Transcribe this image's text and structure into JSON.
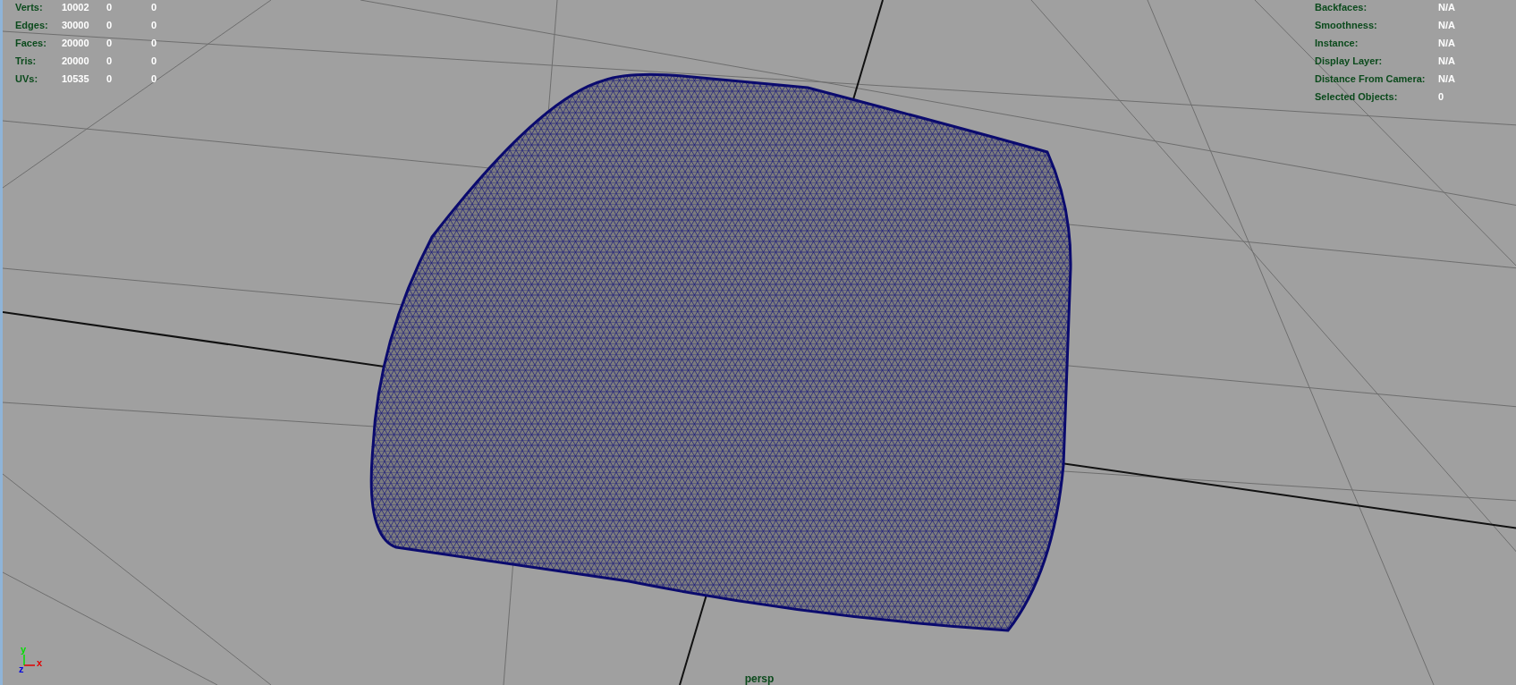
{
  "poly_count": [
    {
      "label": "Verts:",
      "values": [
        "10002",
        "0",
        "0"
      ]
    },
    {
      "label": "Edges:",
      "values": [
        "30000",
        "0",
        "0"
      ]
    },
    {
      "label": "Faces:",
      "values": [
        "20000",
        "0",
        "0"
      ]
    },
    {
      "label": "Tris:",
      "values": [
        "20000",
        "0",
        "0"
      ]
    },
    {
      "label": "UVs:",
      "values": [
        "10535",
        "0",
        "0"
      ]
    }
  ],
  "object_info": [
    {
      "label": "Backfaces:",
      "value": "N/A"
    },
    {
      "label": "Smoothness:",
      "value": "N/A"
    },
    {
      "label": "Instance:",
      "value": "N/A"
    },
    {
      "label": "Display Layer:",
      "value": "N/A"
    },
    {
      "label": "Distance From Camera:",
      "value": "N/A"
    },
    {
      "label": "Selected Objects:",
      "value": "0"
    }
  ],
  "axis": {
    "x": "x",
    "y": "y",
    "z": "z"
  },
  "camera_name": "persp"
}
